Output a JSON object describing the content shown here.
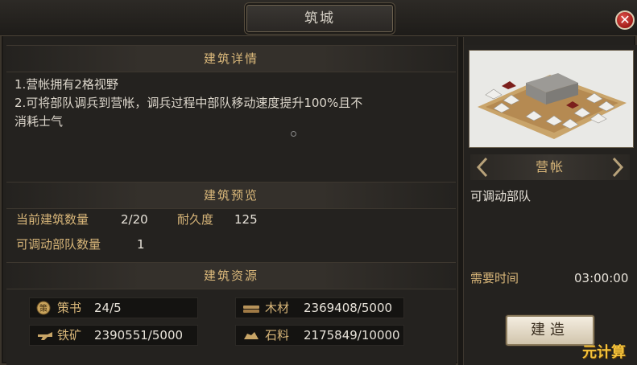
{
  "window": {
    "title": "筑城"
  },
  "details": {
    "header": "建筑详情",
    "lines": [
      "1.营帐拥有2格视野",
      "2.可将部队调兵到营帐，调兵过程中部队移动速度提升100%且不",
      "消耗士气"
    ]
  },
  "preview_section": {
    "header": "建筑预览",
    "count_label": "当前建筑数量",
    "count_value": "2/20",
    "durability_label": "耐久度",
    "durability_value": "125",
    "troops_label": "可调动部队数量",
    "troops_value": "1"
  },
  "resources": {
    "header": "建筑资源",
    "items": [
      {
        "icon": "book-icon",
        "label": "策书",
        "value": "24/5"
      },
      {
        "icon": "wood-icon",
        "label": "木材",
        "value": "2369408/5000"
      },
      {
        "icon": "iron-icon",
        "label": "铁矿",
        "value": "2390551/5000"
      },
      {
        "icon": "stone-icon",
        "label": "石料",
        "value": "2175849/10000"
      }
    ]
  },
  "building": {
    "name": "营帐",
    "description": "可调动部队",
    "time_label": "需要时间",
    "time_value": "03:00:00",
    "build_label": "建造"
  },
  "watermark": "元计算",
  "colors": {
    "accent_gold": "#d8b679",
    "close_red": "#c0302a"
  }
}
